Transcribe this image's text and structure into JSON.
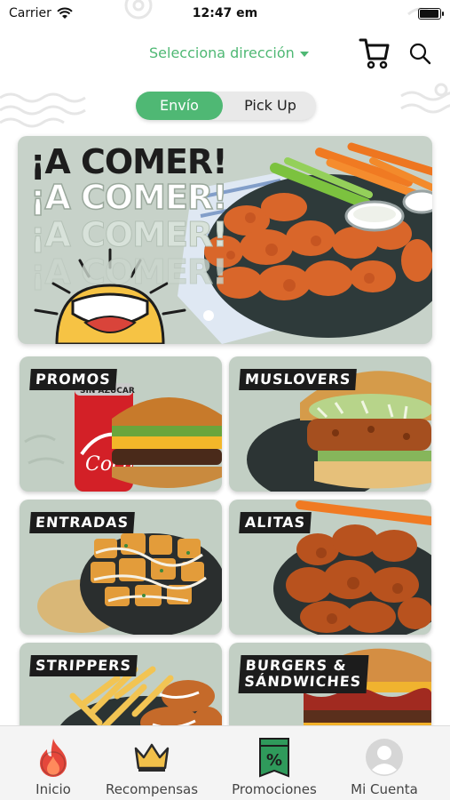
{
  "status_bar": {
    "carrier": "Carrier",
    "time": "12:47 em"
  },
  "header": {
    "address_label": "Selecciona dirección",
    "address_color": "#4fb874"
  },
  "delivery_toggle": {
    "options": [
      "Envío",
      "Pick Up"
    ],
    "selected": "Envío"
  },
  "banner": {
    "lines": [
      "¡A COMER!",
      "¡A COMER!",
      "¡A COMER!",
      "¡A COMER!"
    ],
    "carousel_total": 1,
    "carousel_index": 1
  },
  "categories": [
    {
      "label_1": "PROMOS",
      "label_2": "",
      "image": "soda-and-burger"
    },
    {
      "label_1": "MUSLOVERS",
      "label_2": "",
      "image": "chicken-sandwich"
    },
    {
      "label_1": "ENTRADAS",
      "label_2": "",
      "image": "loaded-potatoes"
    },
    {
      "label_1": "ALITAS",
      "label_2": "",
      "image": "buffalo-wings"
    },
    {
      "label_1": "STRIPPERS",
      "label_2": "",
      "image": "fries-and-strips"
    },
    {
      "label_1": "BURGERS &",
      "label_2": "SÁNDWICHES",
      "image": "bacon-burger"
    }
  ],
  "bottom_nav": {
    "items": [
      {
        "label": "Inicio",
        "icon": "flame-icon",
        "color": "#e5473b"
      },
      {
        "label": "Recompensas",
        "icon": "crown-icon",
        "color": "#e8b84a"
      },
      {
        "label": "Promociones",
        "icon": "percent-tag-icon",
        "color": "#2f9a5b"
      },
      {
        "label": "Mi Cuenta",
        "icon": "account-icon",
        "color": "#c9c9c9"
      }
    ]
  },
  "colors": {
    "accent": "#4fb874",
    "tile_bg": "#c2cfc4",
    "label_bg": "#1c1c1c"
  }
}
